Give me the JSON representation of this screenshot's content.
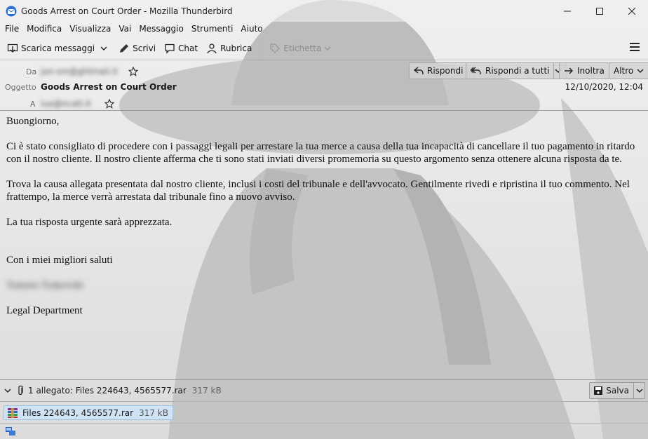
{
  "window": {
    "title": "Goods Arrest on Court Order - Mozilla Thunderbird"
  },
  "menu": [
    "File",
    "Modifica",
    "Visualizza",
    "Vai",
    "Messaggio",
    "Strumenti",
    "Aiuto"
  ],
  "toolbar": {
    "get_messages": "Scarica messaggi",
    "write": "Scrivi",
    "chat": "Chat",
    "address_book": "Rubrica",
    "tag": "Etichetta"
  },
  "header": {
    "from_label": "Da",
    "from_value": "jon-sm@ghtmail.it",
    "subject_label": "Oggetto",
    "subject": "Goods Arrest on Court Order",
    "to_label": "A",
    "to_value": "iuo@ncatl.it",
    "date": "12/10/2020, 12:04",
    "reply": "Rispondi",
    "reply_all": "Rispondi a tutti",
    "forward": "Inoltra",
    "more": "Altro"
  },
  "message": {
    "greeting": "Buongiorno,",
    "para1": "Ci è stato consigliato di procedere con i passaggi legali per arrestare la tua merce a causa della tua incapacità di cancellare il tuo pagamento in ritardo con il nostro cliente. Il nostro cliente afferma che ti sono stati inviati diversi promemoria su questo argomento senza ottenere alcuna risposta da te.",
    "para2": "Trova la causa allegata presentata dal nostro cliente, inclusi i costi del tribunale e dell'avvocato. Gentilmente rivedi e ripristina il tuo commento. Nel frattempo, la merce verrà arrestata dal tribunale fino a nuovo avviso.",
    "para3": "La tua risposta urgente sarà apprezzata.",
    "closing": "Con i miei migliori saluti",
    "signature_name": "Tomoto Trakovski",
    "department": "Legal Department"
  },
  "attachments": {
    "summary": "1 allegato: Files 224643, 4565577.rar",
    "summary_size": "317 kB",
    "save": "Salva",
    "items": [
      {
        "name": "Files 224643, 4565577.rar",
        "size": "317 kB"
      }
    ]
  }
}
